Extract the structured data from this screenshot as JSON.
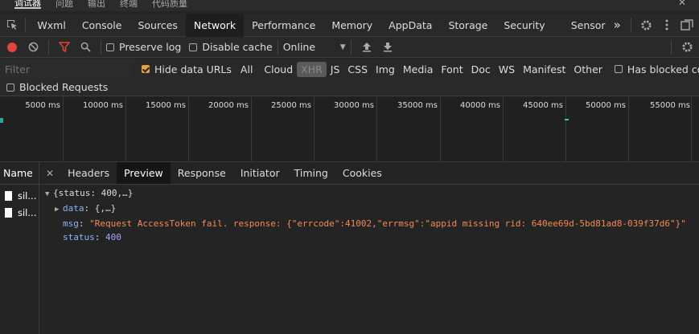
{
  "top_tabs": [
    "调试器",
    "问题",
    "输出",
    "终端",
    "代码质量"
  ],
  "top_right": {
    "more": "⋯",
    "close": "✕"
  },
  "main_tabs": [
    "Wxml",
    "Console",
    "Sources",
    "Network",
    "Performance",
    "Memory",
    "AppData",
    "Storage",
    "Security",
    "Sensor"
  ],
  "active_main_tab": "Network",
  "more_tabs": "»",
  "toolbar": {
    "preserve_log": "Preserve log",
    "disable_cache": "Disable cache",
    "throttle": "Online"
  },
  "filter": {
    "placeholder": "Filter",
    "hide_data_urls": "Hide data URLs",
    "types": [
      "All",
      "Cloud",
      "XHR",
      "JS",
      "CSS",
      "Img",
      "Media",
      "Font",
      "Doc",
      "WS",
      "Manifest",
      "Other"
    ],
    "selected_type": "XHR",
    "has_blocked_cookies": "Has blocked cookies",
    "blocked_requests": "Blocked Requests"
  },
  "timeline": {
    "ticks": [
      "5000 ms",
      "10000 ms",
      "15000 ms",
      "20000 ms",
      "25000 ms",
      "30000 ms",
      "35000 ms",
      "40000 ms",
      "45000 ms",
      "50000 ms",
      "55000 ms"
    ]
  },
  "requests": {
    "header": "Name",
    "items": [
      "sil...",
      "sil..."
    ]
  },
  "detail_tabs": [
    "Headers",
    "Preview",
    "Response",
    "Initiator",
    "Timing",
    "Cookies"
  ],
  "active_detail_tab": "Preview",
  "preview": {
    "root": "{status: 400,…}",
    "data_key": "data",
    "data_val": "{,…}",
    "msg_key": "msg",
    "msg_val": "\"Request AccessToken fail. response: {\"errcode\":41002,\"errmsg\":\"appid missing rid: 640ee69d-5bd81ad8-039f37d6\"}\"",
    "status_key": "status",
    "status_val": "400"
  },
  "colors": {
    "accent": "#e8a33b",
    "record": "#e0443e",
    "filter_icon": "#e0443e",
    "key": "#8ab4f8",
    "string": "#f28b54"
  }
}
